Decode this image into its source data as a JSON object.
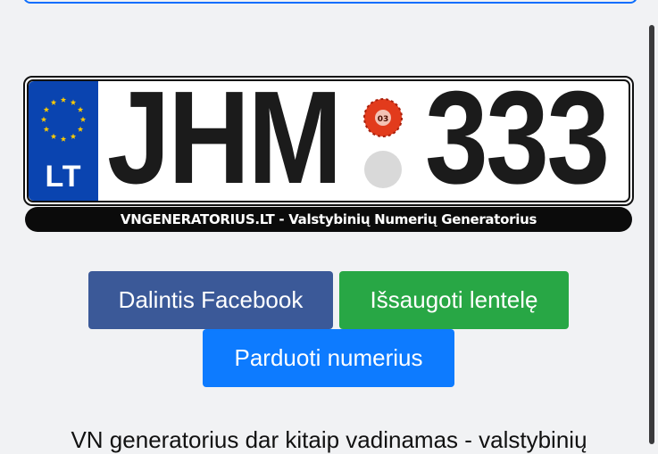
{
  "plate": {
    "country_code": "LT",
    "letters": "JHM",
    "numbers": "333",
    "sticker_text": "03",
    "frame_text": "VNGENERATORIUS.LT - Valstybinių Numerių Generatorius",
    "colors": {
      "eu_band": "#0a44b0",
      "eu_stars": "#ffcc00",
      "sticker": "#e23b1c",
      "frame": "#0b0b0b"
    }
  },
  "buttons": {
    "facebook": "Dalintis Facebook",
    "save": "Išsaugoti lentelę",
    "sell": "Parduoti numerius"
  },
  "button_colors": {
    "facebook": "#3b5998",
    "save": "#28a745",
    "sell": "#0d7bff"
  },
  "intro_text": "VN generatorius dar kitaip vadinamas - valstybinių"
}
